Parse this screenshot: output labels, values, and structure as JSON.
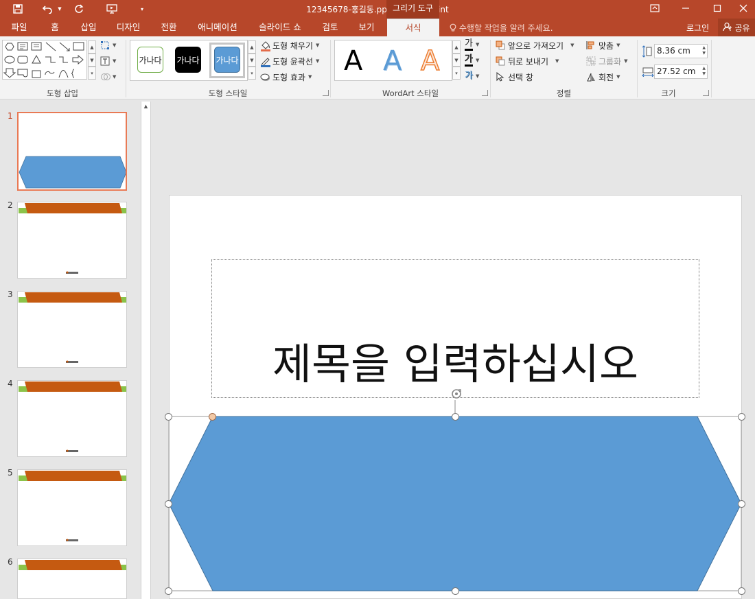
{
  "titlebar": {
    "title": "12345678-홍길동.pptx - PowerPoint",
    "context_tools": "그리기 도구",
    "window_buttons": [
      "restore-ribbon",
      "minimize",
      "maximize",
      "close"
    ]
  },
  "tabs": [
    "파일",
    "홈",
    "삽입",
    "디자인",
    "전환",
    "애니메이션",
    "슬라이드 쇼",
    "검토",
    "보기",
    "서식"
  ],
  "active_tab": "서식",
  "tell_me": "수행할 작업을 알려 주세요.",
  "login": "로그인",
  "share": "공유",
  "ribbon": {
    "insert_shapes": {
      "label": "도형 삽입"
    },
    "shape_styles": {
      "label": "도형 스타일",
      "swatches": [
        {
          "text": "가나다",
          "fill": "#ffffff",
          "border": "#70ad47",
          "color": "#222222"
        },
        {
          "text": "가나다",
          "fill": "#000000",
          "border": "#000000",
          "color": "#ffffff"
        },
        {
          "text": "가나다",
          "fill": "#5b9bd5",
          "border": "#41719c",
          "color": "#ffffff"
        }
      ],
      "fill": "도형 채우기",
      "outline": "도형 윤곽선",
      "effects": "도형 효과"
    },
    "wordart": {
      "label": "WordArt 스타일",
      "letter": "A",
      "text_fill_glyph": "가",
      "text_outline_glyph": "가",
      "text_effect_glyph": "가"
    },
    "arrange": {
      "label": "정렬",
      "bring_forward": "앞으로 가져오기",
      "send_backward": "뒤로 보내기",
      "selection_pane": "선택 창",
      "align": "맞춤",
      "group": "그룹화",
      "rotate": "회전"
    },
    "size": {
      "label": "크기",
      "height": "8.36 cm",
      "width": "27.52 cm"
    }
  },
  "thumbnails": [
    {
      "number": "1",
      "selected": true
    },
    {
      "number": "2"
    },
    {
      "number": "3"
    },
    {
      "number": "4"
    },
    {
      "number": "5"
    },
    {
      "number": "6"
    }
  ],
  "slide": {
    "title_placeholder": "제목을 입력하십시오"
  },
  "colors": {
    "accent": "#b7472a",
    "shape_fill": "#5b9bd5",
    "thumb_bar": "#c55a11",
    "thumb_green": "#8bc34a"
  }
}
